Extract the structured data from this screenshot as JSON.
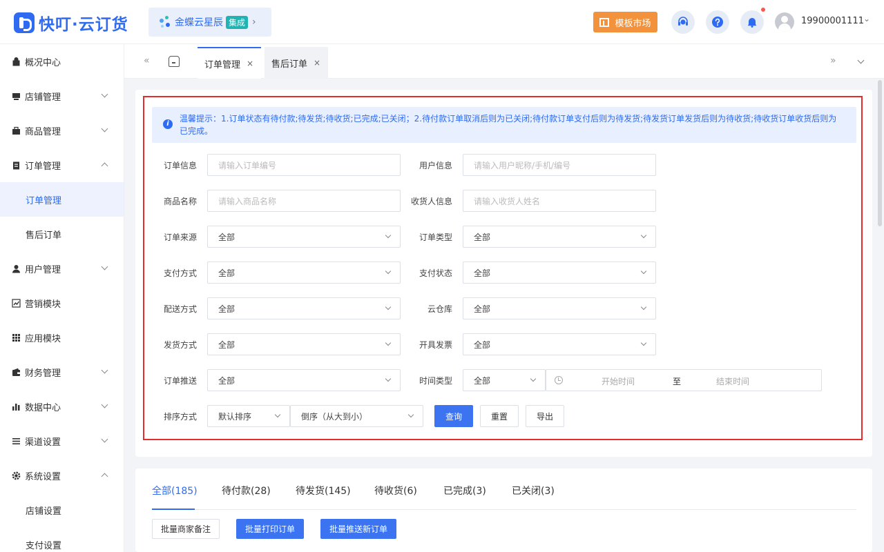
{
  "header": {
    "logo_text": "快叮·云订货",
    "brand_name": "金蝶云星辰",
    "brand_tag": "集成",
    "brand_arrow": "›",
    "template_market": "模板市场",
    "user": "19900001111",
    "user_caret": "⌄",
    "colors": {
      "accent": "#2f6bf1",
      "template_button": "#f3923c",
      "brand_tag": "#20b3b2",
      "notify_dot": "#f45b4f"
    }
  },
  "sidebar": {
    "items": [
      {
        "label": "概况中心",
        "icon": "dashboard-icon"
      },
      {
        "label": "店铺管理",
        "icon": "store-icon"
      },
      {
        "label": "商品管理",
        "icon": "goods-icon"
      },
      {
        "label": "订单管理",
        "icon": "order-icon"
      },
      {
        "label": "订单管理"
      },
      {
        "label": "售后订单"
      },
      {
        "label": "用户管理",
        "icon": "user-icon"
      },
      {
        "label": "营销模块",
        "icon": "marketing-icon"
      },
      {
        "label": "应用模块",
        "icon": "apps-icon"
      },
      {
        "label": "财务管理",
        "icon": "wallet-icon"
      },
      {
        "label": "数据中心",
        "icon": "chart-icon"
      },
      {
        "label": "渠道设置",
        "icon": "channel-icon"
      },
      {
        "label": "系统设置",
        "icon": "gear-icon"
      },
      {
        "label": "店铺设置"
      },
      {
        "label": "支付设置"
      }
    ]
  },
  "tabbar": {
    "collapse": "«",
    "expand": "»",
    "close": "×",
    "tabs": [
      {
        "label": "订单管理"
      },
      {
        "label": "售后订单"
      }
    ]
  },
  "filter": {
    "notice": "温馨提示：1.订单状态有待付款;待发货;待收货;已完成;已关闭；2.待付款订单取消后则为已关闭;待付款订单支付后则为待发货;待发货订单发货后则为待收货;待收货订单收货后则为已完成。",
    "notice_icon": "i",
    "order_info_label": "订单信息",
    "order_info_placeholder": "请输入订单编号",
    "user_info_label": "用户信息",
    "user_info_placeholder": "请输入用户昵称/手机/编号",
    "goods_name_label": "商品名称",
    "goods_name_placeholder": "请输入商品名称",
    "consignee_label": "收货人信息",
    "consignee_placeholder": "请输入收货人姓名",
    "order_source_label": "订单来源",
    "order_type_label": "订单类型",
    "pay_method_label": "支付方式",
    "pay_status_label": "支付状态",
    "delivery_label": "配送方式",
    "warehouse_label": "云仓库",
    "ship_method_label": "发货方式",
    "invoice_label": "开具发票",
    "order_push_label": "订单推送",
    "time_type_label": "时间类型",
    "all_value": "全部",
    "start_time": "开始时间",
    "range_sep": "至",
    "end_time": "结束时间",
    "sort_label": "排序方式",
    "sort_value": "默认排序",
    "order_value": "倒序（从大到小）",
    "query": "查询",
    "reset": "重置",
    "export": "导出"
  },
  "orders": {
    "tabs": [
      {
        "label": "全部(185)"
      },
      {
        "label": "待付款(28)"
      },
      {
        "label": "待发货(145)"
      },
      {
        "label": "待收货(6)"
      },
      {
        "label": "已完成(3)"
      },
      {
        "label": "已关闭(3)"
      }
    ],
    "remark_btn": "批量商家备注",
    "print_btn": "批量打印订单",
    "push_btn": "批量推送新订单"
  }
}
